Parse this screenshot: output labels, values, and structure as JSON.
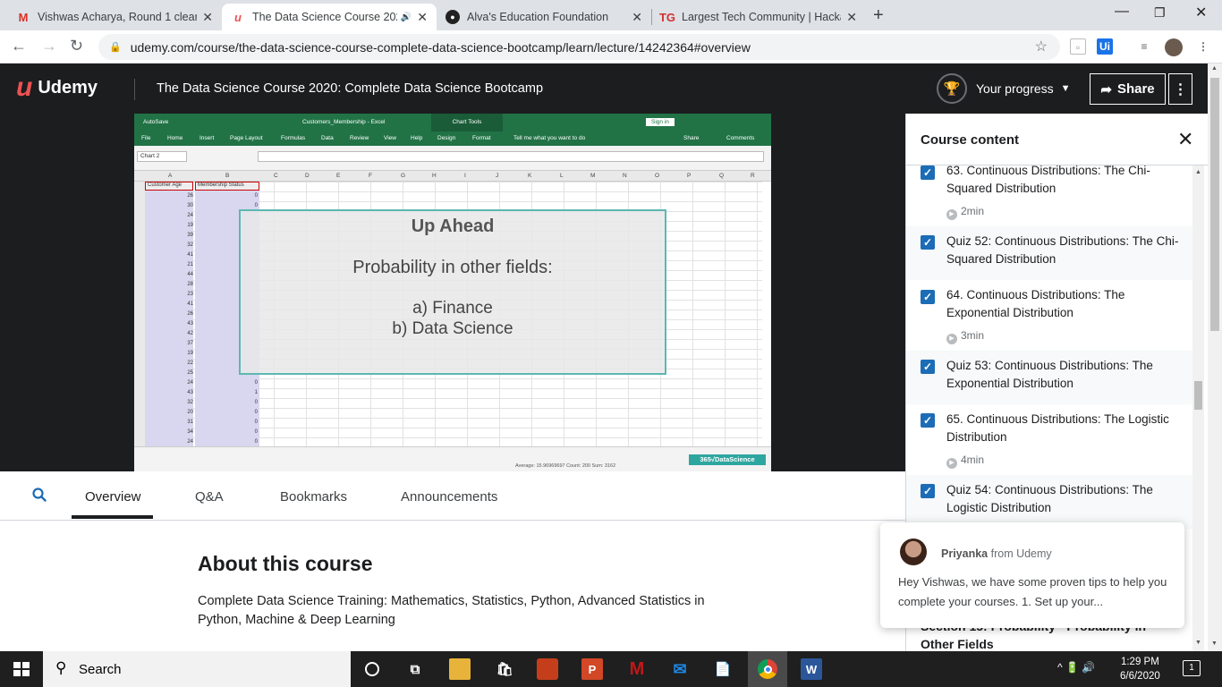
{
  "browser": {
    "tabs": [
      {
        "label": "Vishwas Acharya, Round 1 cleare",
        "icon": "gmail-icon",
        "active": false
      },
      {
        "label": "The Data Science Course 202",
        "icon": "udemy-icon",
        "active": true
      },
      {
        "label": "Alva's Education Foundation",
        "icon": "github-icon",
        "active": false
      },
      {
        "label": "Largest Tech Community | Hackat",
        "icon": "tg-icon",
        "active": false
      }
    ],
    "url": "udemy.com/course/the-data-science-course-complete-data-science-bootcamp/learn/lecture/14242364#overview"
  },
  "header": {
    "logo_text": "Udemy",
    "course_title": "The Data Science Course 2020: Complete Data Science Bootcamp",
    "progress_label": "Your progress",
    "share_label": "Share"
  },
  "video": {
    "excel": {
      "autosave": "AutoSave",
      "file_title": "Customers_Membership - Excel",
      "chart_tools": "Chart Tools",
      "sign_in": "Sign in",
      "ribbon": [
        "File",
        "Home",
        "Insert",
        "Page Layout",
        "Formulas",
        "Data",
        "Review",
        "View",
        "Help",
        "Design",
        "Format",
        "Tell me what you want to do"
      ],
      "share": "Share",
      "comments": "Comments",
      "namebox": "Chart 2",
      "columns": [
        "A",
        "B",
        "C",
        "D",
        "E",
        "F",
        "G",
        "H",
        "I",
        "J",
        "K",
        "L",
        "M",
        "N",
        "O",
        "P",
        "Q",
        "R"
      ],
      "header_a": "Customer Age",
      "header_b": "Membership Status",
      "ages": [
        26,
        30,
        24,
        19,
        39,
        32,
        41,
        21,
        44,
        28,
        23,
        41,
        26,
        43,
        42,
        37,
        19,
        22,
        25,
        24,
        43,
        32,
        20,
        31,
        34,
        24
      ],
      "status_visible": [
        "0",
        "0",
        "",
        "",
        "",
        "",
        "",
        "",
        "",
        "",
        "",
        "",
        "",
        "",
        "",
        "",
        "",
        "",
        "",
        "0",
        "1",
        "0",
        "0",
        "0",
        "0",
        "0"
      ],
      "status_bar": "Average: 15.96969697    Count: 200    Sum: 3162",
      "brand": "365√DataScience"
    },
    "overlay": {
      "heading": "Up Ahead",
      "line1": "Probability in other fields:",
      "line2": "a) Finance",
      "line3": "b) Data Science"
    }
  },
  "lecture_tabs": [
    "Overview",
    "Q&A",
    "Bookmarks",
    "Announcements"
  ],
  "about": {
    "title": "About this course",
    "description": "Complete Data Science Training: Mathematics, Statistics, Python, Advanced Statistics in Python, Machine & Deep Learning"
  },
  "sidebar": {
    "title": "Course content",
    "items": [
      {
        "title": "63. Continuous Distributions: The Chi-Squared Distribution",
        "duration": "2min",
        "checked": true
      },
      {
        "title": "Quiz 52: Continuous Distributions: The Chi-Squared Distribution",
        "duration": "",
        "checked": true
      },
      {
        "title": "64. Continuous Distributions: The Exponential Distribution",
        "duration": "3min",
        "checked": true
      },
      {
        "title": "Quiz 53: Continuous Distributions: The Exponential Distribution",
        "duration": "",
        "checked": true
      },
      {
        "title": "65. Continuous Distributions: The Logistic Distribution",
        "duration": "4min",
        "checked": true
      },
      {
        "title": "Quiz 54: Continuous Distributions: The Logistic Distribution",
        "duration": "",
        "checked": true
      }
    ],
    "section_partial": "Section 15: Probability - Probability in Other Fields"
  },
  "chat": {
    "name": "Priyanka",
    "from_text": "from Udemy",
    "message": "Hey Vishwas, we have some proven tips to help you complete your courses. 1. Set up your..."
  },
  "taskbar": {
    "search_label": "Search",
    "time": "1:29 PM",
    "date": "6/6/2020",
    "notification_count": "1"
  },
  "colors": {
    "udemy_red": "#ec5252",
    "check_blue": "#1c6cb6",
    "header_dark": "#1c1d1f",
    "excel_green": "#217346"
  }
}
